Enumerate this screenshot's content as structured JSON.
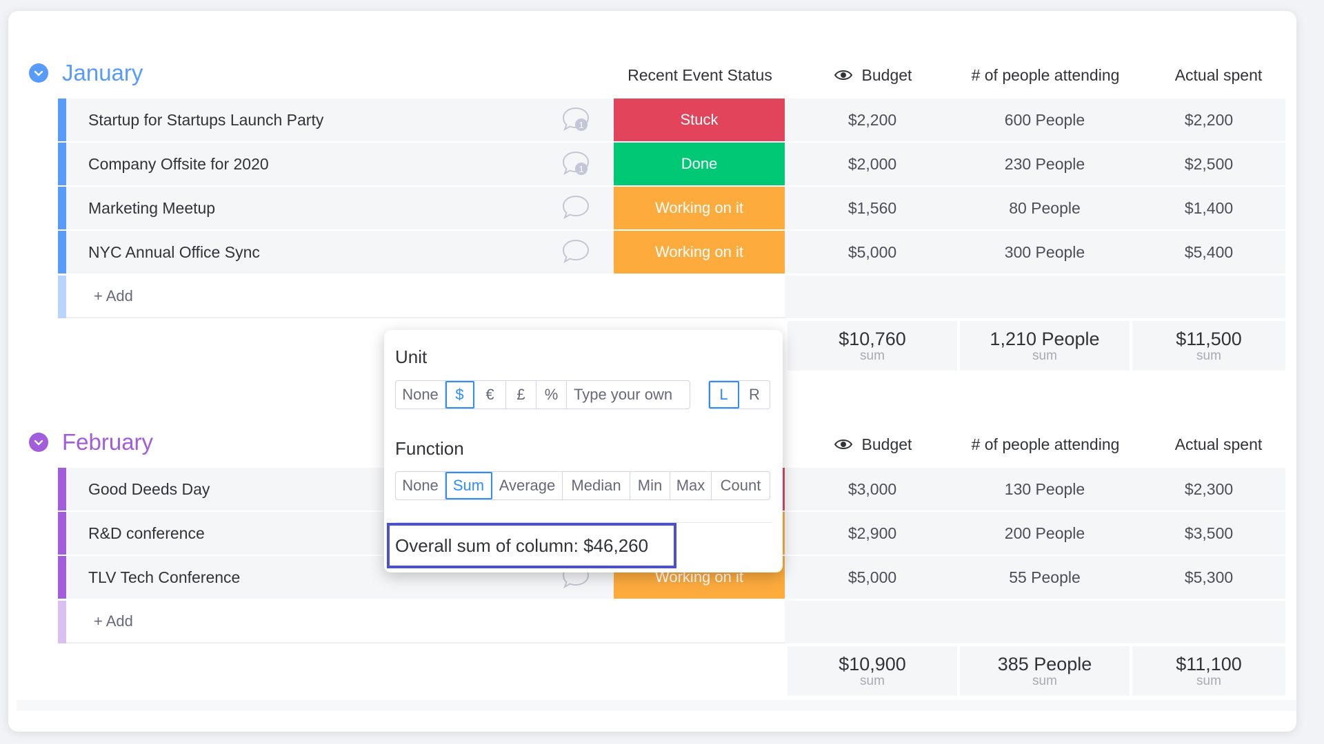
{
  "columns": {
    "status": "Recent Event Status",
    "budget": "Budget",
    "people": "# of people attending",
    "spent": "Actual spent"
  },
  "groups": [
    {
      "name": "January",
      "color": "#579bfc",
      "add_label": "+ Add",
      "rows": [
        {
          "name": "Startup for Startups Launch Party",
          "status": "Stuck",
          "status_color": "#e2445c",
          "budget": "$2,200",
          "people": "600 People",
          "spent": "$2,200",
          "chat": "1"
        },
        {
          "name": "Company Offsite for 2020",
          "status": "Done",
          "status_color": "#00c875",
          "budget": "$2,000",
          "people": "230 People",
          "spent": "$2,500",
          "chat": "1"
        },
        {
          "name": "Marketing Meetup",
          "status": "Working on it",
          "status_color": "#fdab3d",
          "budget": "$1,560",
          "people": "80 People",
          "spent": "$1,400",
          "chat": ""
        },
        {
          "name": "NYC Annual Office Sync",
          "status": "Working on it",
          "status_color": "#fdab3d",
          "budget": "$5,000",
          "people": "300 People",
          "spent": "$5,400",
          "chat": ""
        }
      ],
      "summary": {
        "budget": "$10,760",
        "people": "1,210 People",
        "spent": "$11,500",
        "label": "sum"
      }
    },
    {
      "name": "February",
      "color": "#a25ddc",
      "add_label": "+ Add",
      "rows": [
        {
          "name": "Good Deeds Day",
          "status": "",
          "status_color": "#e2445c",
          "budget": "$3,000",
          "people": "130 People",
          "spent": "$2,300",
          "chat": ""
        },
        {
          "name": "R&D conference",
          "status": "",
          "status_color": "#fdab3d",
          "budget": "$2,900",
          "people": "200 People",
          "spent": "$3,500",
          "chat": ""
        },
        {
          "name": "TLV Tech Conference",
          "status": "Working on it",
          "status_color": "#fdab3d",
          "budget": "$5,000",
          "people": "55 People",
          "spent": "$5,300",
          "chat": ""
        }
      ],
      "summary": {
        "budget": "$10,900",
        "people": "385 People",
        "spent": "$11,100",
        "label": "sum"
      }
    }
  ],
  "popup": {
    "unit_title": "Unit",
    "unit_options": [
      "None",
      "$",
      "€",
      "£",
      "%"
    ],
    "unit_custom_placeholder": "Type your own",
    "unit_selected": "$",
    "align_options": [
      "L",
      "R"
    ],
    "align_selected": "L",
    "function_title": "Function",
    "function_options": [
      "None",
      "Sum",
      "Average",
      "Median",
      "Min",
      "Max",
      "Count"
    ],
    "function_selected": "Sum",
    "overall_text": "Overall sum of column: $46,260",
    "highlight_color": "#4a4fd9"
  },
  "icons": {
    "group_toggle": "chevron-down-icon",
    "chat": "chat-bubble-icon",
    "budget_visibility": "eye-icon"
  }
}
